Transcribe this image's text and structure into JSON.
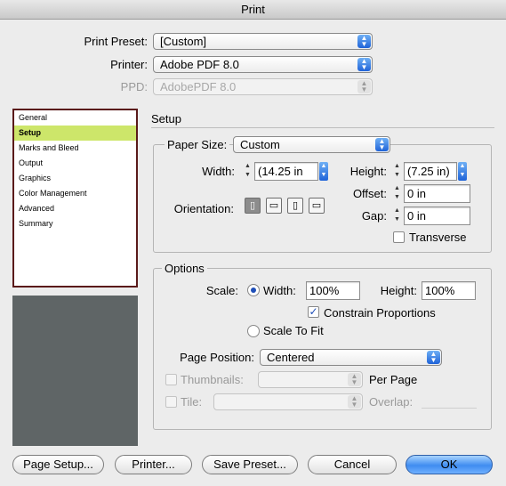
{
  "window": {
    "title": "Print"
  },
  "top": {
    "preset_label": "Print Preset:",
    "preset_value": "[Custom]",
    "printer_label": "Printer:",
    "printer_value": "Adobe PDF 8.0",
    "ppd_label": "PPD:",
    "ppd_value": "AdobePDF 8.0"
  },
  "sidebar": {
    "items": [
      {
        "label": "General"
      },
      {
        "label": "Setup"
      },
      {
        "label": "Marks and Bleed"
      },
      {
        "label": "Output"
      },
      {
        "label": "Graphics"
      },
      {
        "label": "Color Management"
      },
      {
        "label": "Advanced"
      },
      {
        "label": "Summary"
      }
    ],
    "selected": "Setup"
  },
  "setup": {
    "section_title": "Setup",
    "paper_size_label": "Paper Size:",
    "paper_size_value": "Custom",
    "width_label": "Width:",
    "width_value": "(14.25 in",
    "height_label": "Height:",
    "height_value": "(7.25 in)",
    "offset_label": "Offset:",
    "offset_value": "0 in",
    "gap_label": "Gap:",
    "gap_value": "0 in",
    "orientation_label": "Orientation:",
    "orientation_icons": [
      "portrait-icon",
      "landscape-icon",
      "reverse-portrait-icon",
      "reverse-landscape-icon"
    ],
    "transverse_label": "Transverse"
  },
  "options": {
    "group_title": "Options",
    "scale_label": "Scale:",
    "width_radio_label": "Width:",
    "width_value": "100%",
    "height_label": "Height:",
    "height_value": "100%",
    "constrain_label": "Constrain Proportions",
    "scale_to_fit_label": "Scale To Fit",
    "page_position_label": "Page Position:",
    "page_position_value": "Centered",
    "thumbnails_label": "Thumbnails:",
    "per_page_label": "Per Page",
    "tile_label": "Tile:",
    "overlap_label": "Overlap:"
  },
  "buttons": {
    "page_setup": "Page Setup...",
    "printer": "Printer...",
    "save_preset": "Save Preset...",
    "cancel": "Cancel",
    "ok": "OK"
  },
  "colors": {
    "selection": "#cde66a",
    "default_button": "#3f8cf0",
    "list_border": "#5a1a1a",
    "preview": "#5f6566"
  }
}
